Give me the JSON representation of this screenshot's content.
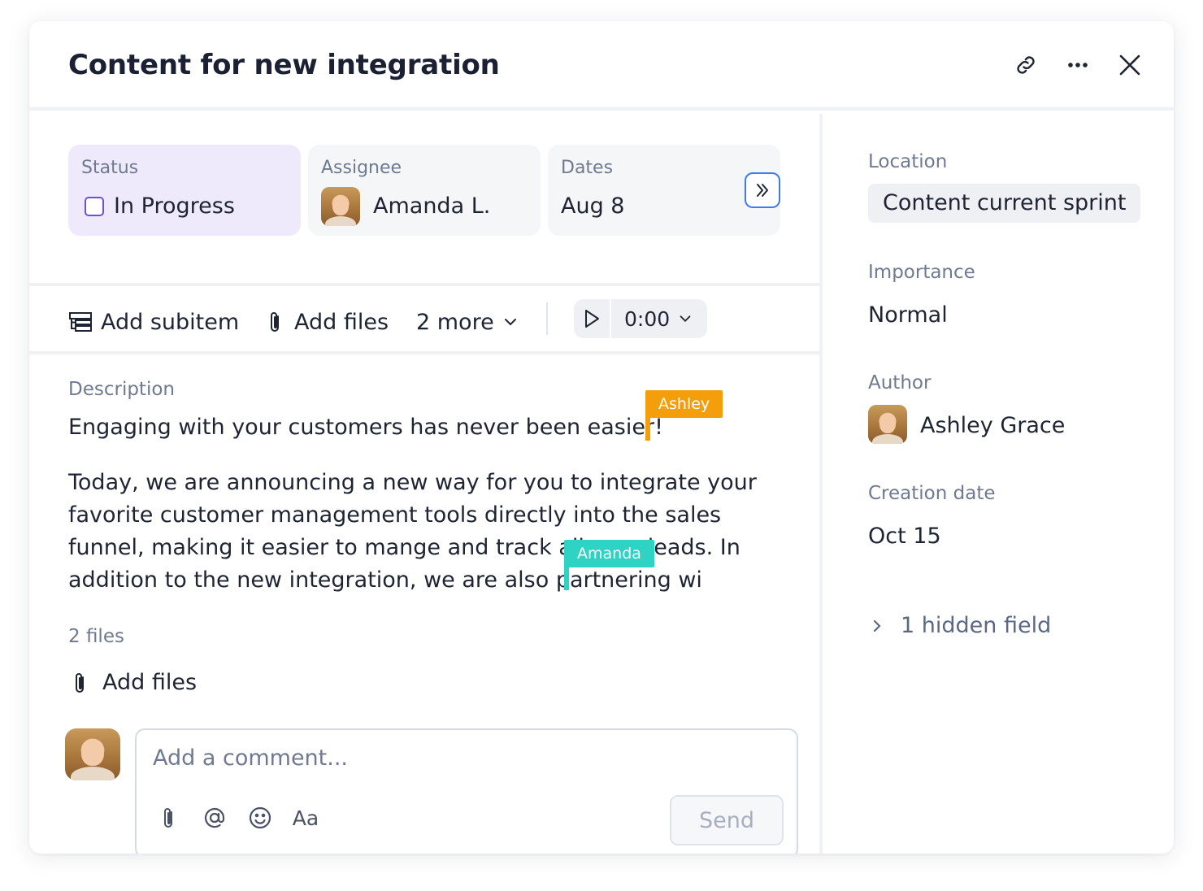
{
  "header": {
    "title": "Content for new integration",
    "icons": [
      "link-icon",
      "more-icon",
      "close-icon"
    ]
  },
  "fields": {
    "status": {
      "label": "Status",
      "value": "In Progress",
      "color": "#6a4fe0"
    },
    "assignee": {
      "label": "Assignee",
      "value": "Amanda L."
    },
    "dates": {
      "label": "Dates",
      "value": "Aug 8"
    }
  },
  "toolbar": {
    "add_subitem": "Add subitem",
    "add_files": "Add files",
    "more": "2 more",
    "timer": "0:00"
  },
  "description": {
    "label": "Description",
    "para1": "Engaging with your customers has never been easier!",
    "para2": "Today, we are announcing a new way for you to integrate your favorite customer management tools directly into the sales funnel, making it easier to mange and track all your leads. In addition to the new integration, we are also partnering wi",
    "cursors": [
      {
        "name": "Ashley",
        "color": "#f59e0b"
      },
      {
        "name": "Amanda",
        "color": "#2fd3c4"
      }
    ]
  },
  "files": {
    "label": "2 files",
    "add_files": "Add files"
  },
  "comment": {
    "placeholder": "Add a comment...",
    "format_label": "Aa",
    "send_label": "Send"
  },
  "sidebar": {
    "location": {
      "label": "Location",
      "value": "Content current sprint"
    },
    "importance": {
      "label": "Importance",
      "value": "Normal"
    },
    "author": {
      "label": "Author",
      "value": "Ashley Grace"
    },
    "creation_date": {
      "label": "Creation date",
      "value": "Oct 15"
    },
    "hidden_fields": "1 hidden field"
  }
}
